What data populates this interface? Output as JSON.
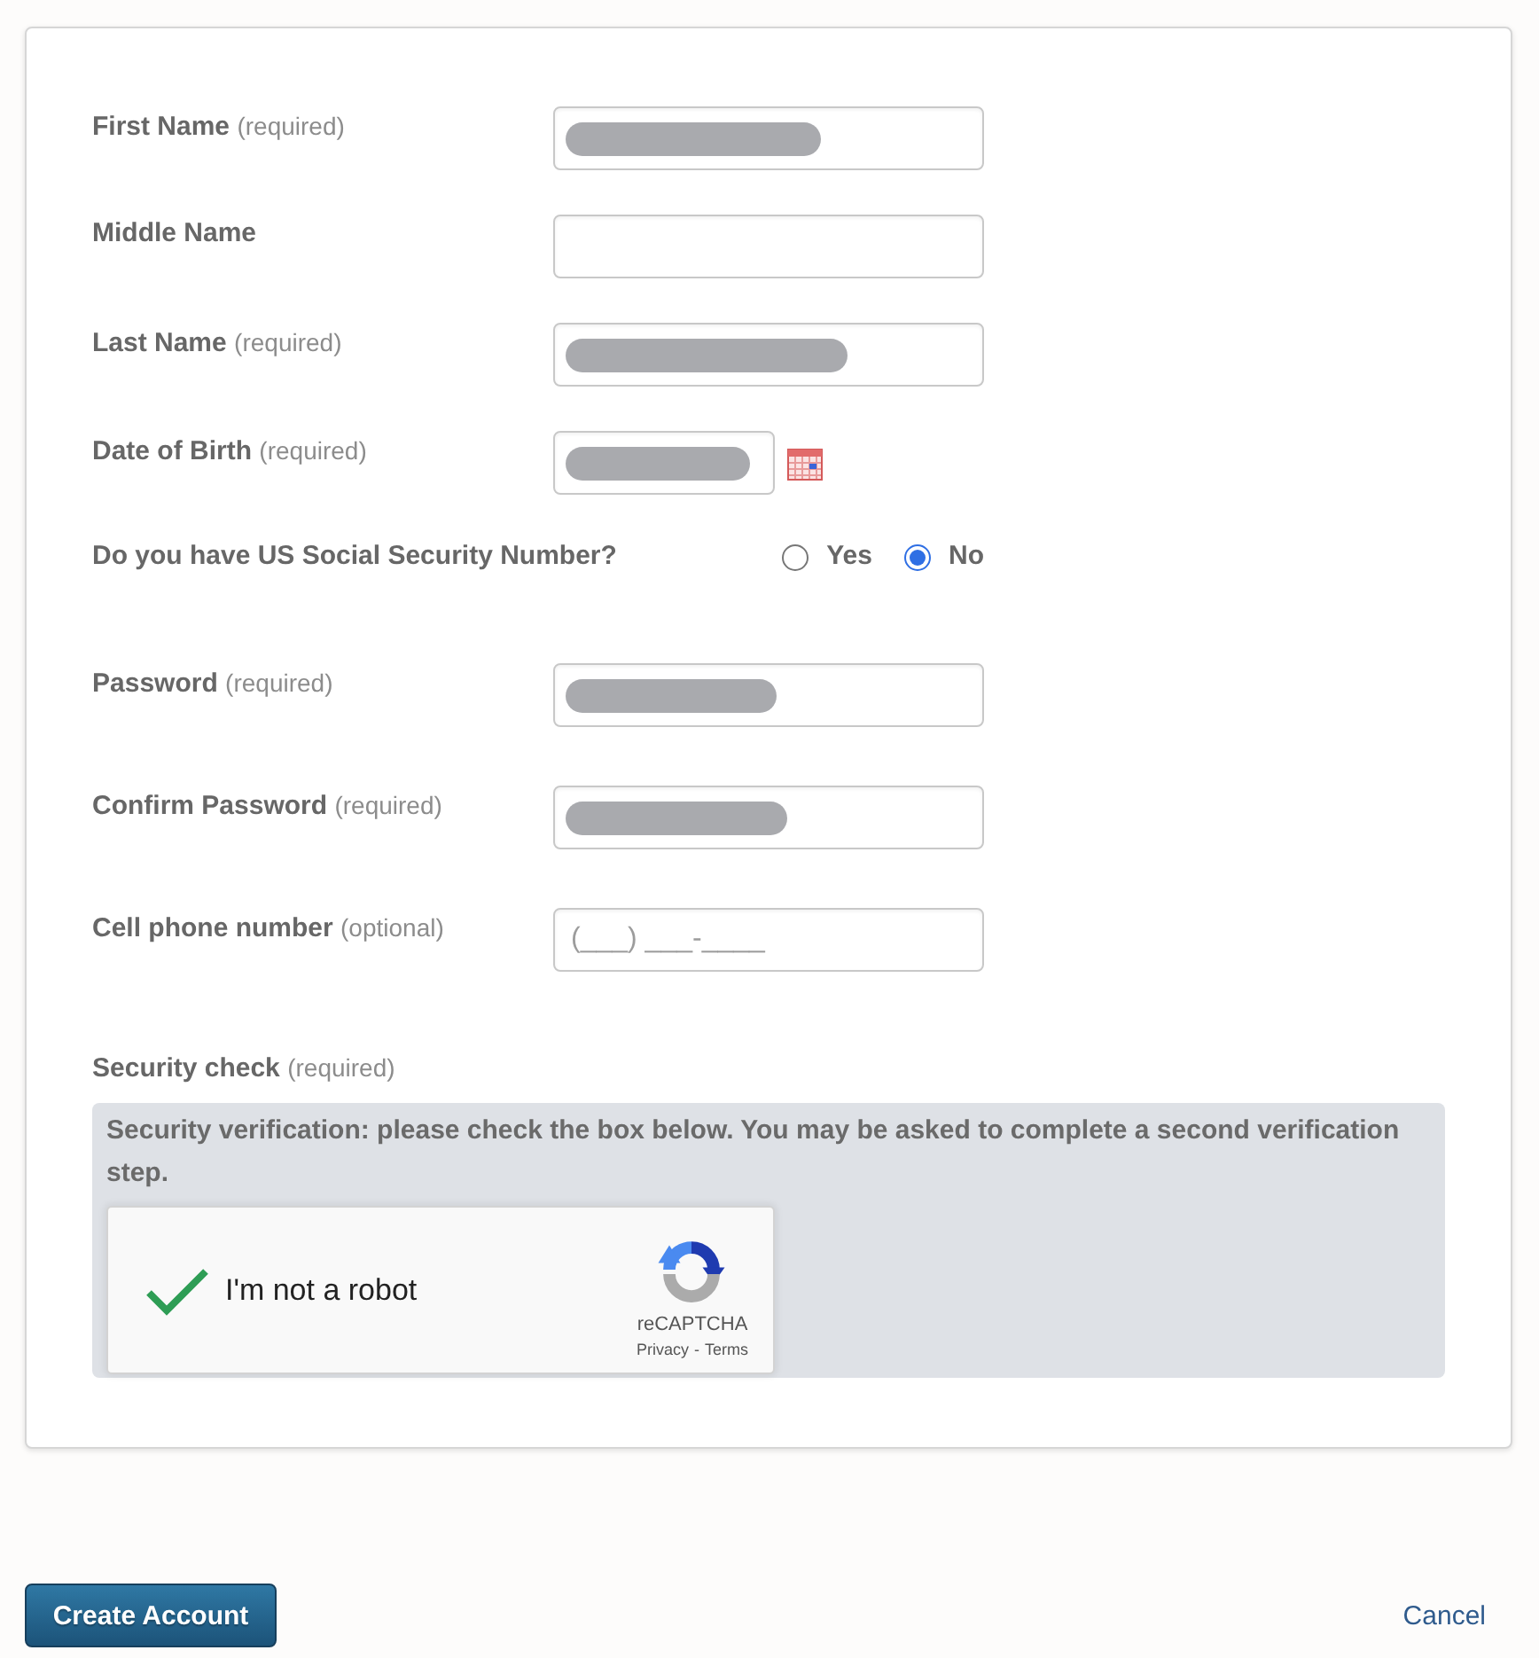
{
  "form": {
    "fields": [
      {
        "kind": "text",
        "label": "First Name",
        "note": "(required)",
        "redacted": true
      },
      {
        "kind": "text",
        "label": "Middle Name"
      },
      {
        "kind": "text",
        "label": "Last Name",
        "note": "(required)",
        "redacted": true
      },
      {
        "kind": "date",
        "label": "Date of Birth",
        "note": "(required)",
        "redacted": true
      },
      {
        "kind": "radio",
        "label": "Do you have US Social Security Number?",
        "options": [
          {
            "label": "Yes",
            "selected": false
          },
          {
            "label": "No",
            "selected": true
          }
        ]
      },
      {
        "kind": "text",
        "label": "Password",
        "note": "(required)",
        "redacted": true
      },
      {
        "kind": "text",
        "label": "Confirm Password",
        "note": "(required)",
        "redacted": true
      },
      {
        "kind": "text",
        "label": "Cell phone number",
        "note": "(optional)",
        "placeholder": "(___) ___-____"
      }
    ]
  },
  "security_check": {
    "label": "Security check",
    "note": "(required)",
    "message": "Security verification: please check the box below. You may be asked to complete a second verification step.",
    "captcha": {
      "checked": true,
      "label": "I'm not a robot",
      "brand": "reCAPTCHA",
      "links": [
        "Privacy",
        "Terms"
      ],
      "separator": "-"
    }
  },
  "actions": {
    "primary": "Create Account",
    "cancel": "Cancel"
  }
}
